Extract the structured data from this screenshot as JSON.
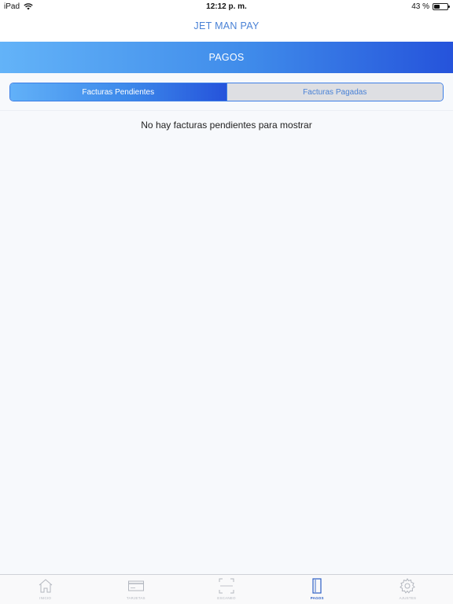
{
  "status_bar": {
    "device": "iPad",
    "time": "12:12 p. m.",
    "battery": "43 %",
    "battery_level": 0.43
  },
  "app": {
    "title": "JET MAN PAY"
  },
  "header": {
    "title": "PAGOS"
  },
  "segmented": {
    "active": "Facturas Pendientes",
    "inactive": "Facturas Pagadas"
  },
  "content": {
    "empty_message": "No hay facturas pendientes para mostrar"
  },
  "tab_bar": {
    "items": [
      {
        "label": "INICIO",
        "icon": "home-icon"
      },
      {
        "label": "TARJETAS",
        "icon": "card-icon"
      },
      {
        "label": "ESCANEO",
        "icon": "scan-icon"
      },
      {
        "label": "PAGOS",
        "icon": "bill-icon",
        "active": true
      },
      {
        "label": "AJUSTES",
        "icon": "gear-icon"
      }
    ]
  },
  "colors": {
    "accent": "#3e7fe6",
    "gradient_start": "#63b3f8",
    "gradient_end": "#2553db",
    "active_tab": "#2c5fc5",
    "inactive_tab": "#b3b7bf"
  }
}
